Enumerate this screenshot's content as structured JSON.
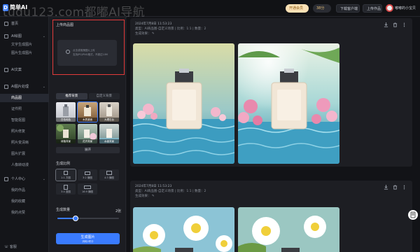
{
  "header": {
    "logo_text": "简单AI",
    "watermark": "tudu123.com都嘟AI导航",
    "vip_label": "开通会员",
    "points_label": "38分",
    "download_label": "下载客户端",
    "upload_label": "上传作品",
    "username": "嘟嘟的小宝贝",
    "colors": {
      "accent": "#3a7bff",
      "vip": "#fbe1b5",
      "highlight_border": "#e23b3b"
    }
  },
  "nav": {
    "items": [
      {
        "label": "首页",
        "icon": "home-icon"
      },
      {
        "label": "AI绘图",
        "icon": "paint-icon"
      },
      {
        "label": "文字生成图片",
        "icon": ""
      },
      {
        "label": "图片生成图片",
        "icon": ""
      },
      {
        "label": "AI文案",
        "icon": "doc-icon"
      },
      {
        "label": "AI图片处理",
        "icon": "image-icon"
      },
      {
        "label": "商品图",
        "icon": ""
      },
      {
        "label": "证件照",
        "icon": ""
      },
      {
        "label": "智能抠图",
        "icon": ""
      },
      {
        "label": "照片修复",
        "icon": ""
      },
      {
        "label": "照片变清晰",
        "icon": ""
      },
      {
        "label": "图片扩展",
        "icon": ""
      },
      {
        "label": "人像转动漫",
        "icon": ""
      },
      {
        "label": "个人中心",
        "icon": "user-icon"
      },
      {
        "label": "我的作品",
        "icon": ""
      },
      {
        "label": "我的收藏",
        "icon": ""
      },
      {
        "label": "我的点赞",
        "icon": ""
      }
    ],
    "footer_label": "客服"
  },
  "panel": {
    "upload_title": "上传商品图",
    "upload_hint_line1": "点击或拖拽图片上传",
    "upload_hint_line2": "支持JPG/PNG格式，不超过10M",
    "tabs": [
      "推荐背景",
      "自定义背景"
    ],
    "thumbnails": [
      {
        "label": "白色纯色",
        "selected": false
      },
      {
        "label": "木质桌面",
        "selected": true
      },
      {
        "label": "大理石台",
        "selected": false
      },
      {
        "label": "绿植背景",
        "selected": false
      },
      {
        "label": "花卉背景",
        "selected": false
      },
      {
        "label": "水面背景",
        "selected": false
      }
    ],
    "expand_label": "展开",
    "ratio_title": "生成比例",
    "ratios": [
      "1:1 方图",
      "3:2 横图",
      "4:3 横图",
      "3:4 竖图",
      "16:9 横图",
      ""
    ],
    "count_title": "生成数量",
    "count_value": "2张",
    "count_fraction": 0.3,
    "generate_label": "生成图片",
    "generate_sub": "消耗2积分"
  },
  "results": [
    {
      "date": "2024年7月8日 11:53:23",
      "meta": "类型：AI商品图-自定义场景 | 比例：1:1 | 数量：2",
      "model": "生成效果：",
      "images": [
        "perfume-scene-1",
        "perfume-scene-2"
      ]
    },
    {
      "date": "2024年7月8日 11:53:23",
      "meta": "类型：AI商品图-自定义场景 | 比例：1:1 | 数量：2",
      "model": "生成效果：",
      "images": [
        "daisy-scene-1",
        "daisy-scene-2"
      ]
    }
  ]
}
